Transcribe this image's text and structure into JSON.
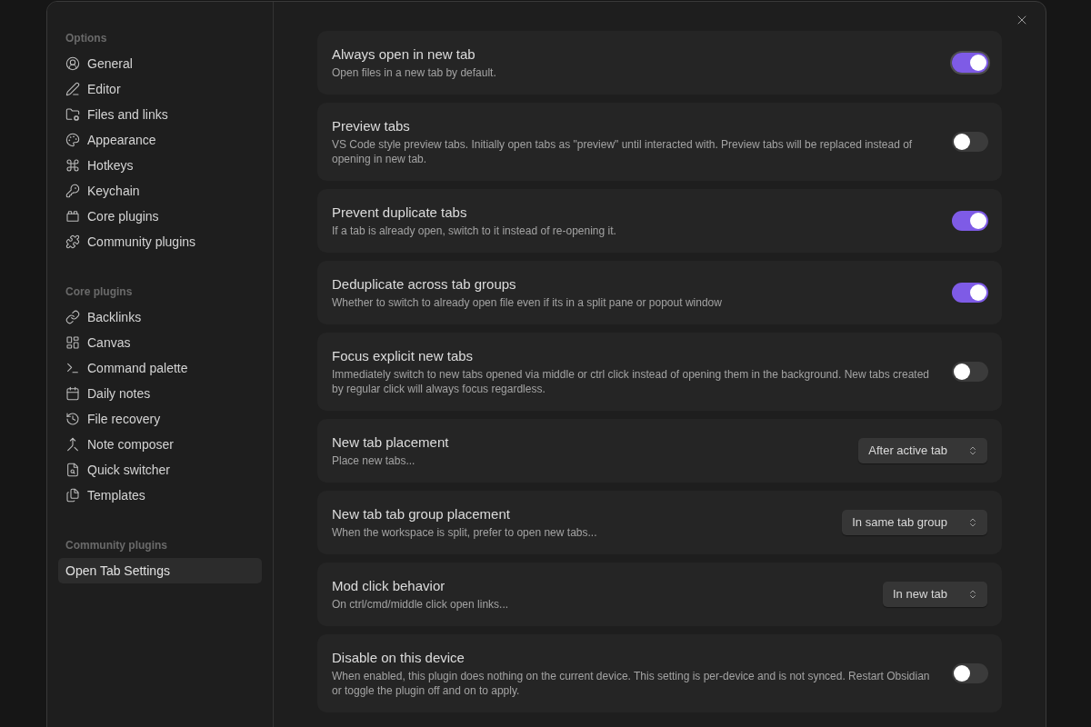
{
  "sidebar": {
    "sections": [
      {
        "heading": "Options",
        "items": [
          {
            "label": "General",
            "selected": false
          },
          {
            "label": "Editor",
            "selected": false
          },
          {
            "label": "Files and links",
            "selected": false
          },
          {
            "label": "Appearance",
            "selected": false
          },
          {
            "label": "Hotkeys",
            "selected": false
          },
          {
            "label": "Keychain",
            "selected": false
          },
          {
            "label": "Core plugins",
            "selected": false
          },
          {
            "label": "Community plugins",
            "selected": false
          }
        ]
      },
      {
        "heading": "Core plugins",
        "items": [
          {
            "label": "Backlinks",
            "selected": false
          },
          {
            "label": "Canvas",
            "selected": false
          },
          {
            "label": "Command palette",
            "selected": false
          },
          {
            "label": "Daily notes",
            "selected": false
          },
          {
            "label": "File recovery",
            "selected": false
          },
          {
            "label": "Note composer",
            "selected": false
          },
          {
            "label": "Quick switcher",
            "selected": false
          },
          {
            "label": "Templates",
            "selected": false
          }
        ]
      },
      {
        "heading": "Community plugins",
        "items": [
          {
            "label": "Open Tab Settings",
            "selected": true
          }
        ]
      }
    ]
  },
  "settings": [
    {
      "kind": "toggle",
      "name": "Always open in new tab",
      "description": "Open files in a new tab by default.",
      "on": true,
      "focused": true
    },
    {
      "kind": "toggle",
      "name": "Preview tabs",
      "description": "VS Code style preview tabs. Initially open tabs as \"preview\" until interacted with. Preview tabs will be replaced instead of opening in new tab.",
      "on": false,
      "focused": false
    },
    {
      "kind": "toggle",
      "name": "Prevent duplicate tabs",
      "description": "If a tab is already open, switch to it instead of re-opening it.",
      "on": true,
      "focused": false
    },
    {
      "kind": "toggle",
      "name": "Deduplicate across tab groups",
      "description": "Whether to switch to already open file even if its in a split pane or popout window",
      "on": true,
      "focused": false
    },
    {
      "kind": "toggle",
      "name": "Focus explicit new tabs",
      "description": "Immediately switch to new tabs opened via middle or ctrl click instead of opening them in the background. New tabs created by regular click will always focus regardless.",
      "on": false,
      "focused": false
    },
    {
      "kind": "dropdown",
      "name": "New tab placement",
      "description": "Place new tabs...",
      "value": "After active tab",
      "focused": false
    },
    {
      "kind": "dropdown",
      "name": "New tab tab group placement",
      "description": "When the workspace is split, prefer to open new tabs...",
      "value": "In same tab group",
      "focused": false
    },
    {
      "kind": "dropdown",
      "name": "Mod click behavior",
      "description": "On ctrl/cmd/middle click open links...",
      "value": "In new tab",
      "focused": false
    },
    {
      "kind": "toggle",
      "name": "Disable on this device",
      "description": "When enabled, this plugin does nothing on the current device. This setting is per-device and is not synced. Restart Obsidian or toggle the plugin off and on to apply.",
      "on": false,
      "focused": false
    }
  ]
}
